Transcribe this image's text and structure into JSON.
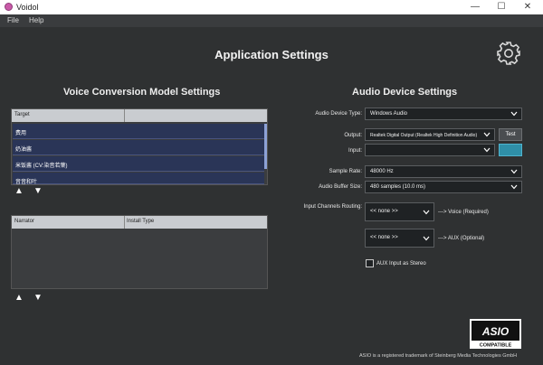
{
  "titlebar": {
    "title": "Voidol",
    "minimize_glyph": "—",
    "maximize_glyph": "☐",
    "close_glyph": "✕"
  },
  "menu": {
    "items": [
      "File",
      "Help"
    ]
  },
  "page": {
    "title": "Application Settings"
  },
  "model": {
    "heading": "Voice Conversion Model Settings",
    "target_table": {
      "header": "Target",
      "rows": [
        "费用",
        "奶油酱",
        "米饭酱 (CV:染音若葉)",
        "音音和叶"
      ]
    },
    "narrator_table": {
      "headers": [
        "Narrator",
        "Install Type"
      ]
    },
    "up_glyph": "▲",
    "down_glyph": "▼"
  },
  "audio": {
    "heading": "Audio Device Settings",
    "device_type": {
      "label": "Audio Device Type:",
      "value": "Windows Audio"
    },
    "output": {
      "label": "Output:",
      "value": "Realtek Digital Output (Realtek High Definition Audio)",
      "test_label": "Test"
    },
    "input": {
      "label": "Input:",
      "value": ""
    },
    "sample_rate": {
      "label": "Sample Rate:",
      "value": "48000 Hz"
    },
    "buffer_size": {
      "label": "Audio Buffer Size:",
      "value": "480 samples (10.0 ms)"
    },
    "routing": {
      "label": "Input Channels Routing:",
      "voice": {
        "value": "<< none >>",
        "caption": "---> Voice (Required)"
      },
      "aux": {
        "value": "<< none >>",
        "caption": "---> AUX (Optional)"
      }
    },
    "aux_stereo": {
      "label": "AUX Input as Stereo",
      "checked": false
    }
  },
  "footer": {
    "asio_logo_text": "ASIO",
    "asio_logo_sub": "COMPATIBLE",
    "trademark": "ASIO is a registered trademark of Steinberg Media Technologies GmbH"
  },
  "colors": {
    "background": "#2f3132",
    "row_selected": "#2a3557",
    "accent_meter": "#2f8fa8"
  }
}
